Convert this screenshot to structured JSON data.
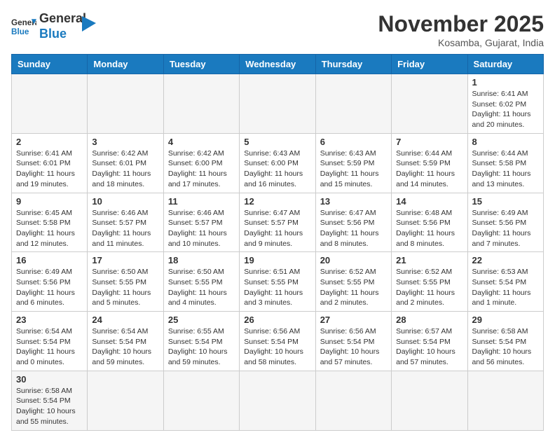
{
  "logo": {
    "text_general": "General",
    "text_blue": "Blue"
  },
  "header": {
    "month": "November 2025",
    "location": "Kosamba, Gujarat, India"
  },
  "weekdays": [
    "Sunday",
    "Monday",
    "Tuesday",
    "Wednesday",
    "Thursday",
    "Friday",
    "Saturday"
  ],
  "weeks": [
    [
      {
        "day": "",
        "info": ""
      },
      {
        "day": "",
        "info": ""
      },
      {
        "day": "",
        "info": ""
      },
      {
        "day": "",
        "info": ""
      },
      {
        "day": "",
        "info": ""
      },
      {
        "day": "",
        "info": ""
      },
      {
        "day": "1",
        "info": "Sunrise: 6:41 AM\nSunset: 6:02 PM\nDaylight: 11 hours\nand 20 minutes."
      }
    ],
    [
      {
        "day": "2",
        "info": "Sunrise: 6:41 AM\nSunset: 6:01 PM\nDaylight: 11 hours\nand 19 minutes."
      },
      {
        "day": "3",
        "info": "Sunrise: 6:42 AM\nSunset: 6:01 PM\nDaylight: 11 hours\nand 18 minutes."
      },
      {
        "day": "4",
        "info": "Sunrise: 6:42 AM\nSunset: 6:00 PM\nDaylight: 11 hours\nand 17 minutes."
      },
      {
        "day": "5",
        "info": "Sunrise: 6:43 AM\nSunset: 6:00 PM\nDaylight: 11 hours\nand 16 minutes."
      },
      {
        "day": "6",
        "info": "Sunrise: 6:43 AM\nSunset: 5:59 PM\nDaylight: 11 hours\nand 15 minutes."
      },
      {
        "day": "7",
        "info": "Sunrise: 6:44 AM\nSunset: 5:59 PM\nDaylight: 11 hours\nand 14 minutes."
      },
      {
        "day": "8",
        "info": "Sunrise: 6:44 AM\nSunset: 5:58 PM\nDaylight: 11 hours\nand 13 minutes."
      }
    ],
    [
      {
        "day": "9",
        "info": "Sunrise: 6:45 AM\nSunset: 5:58 PM\nDaylight: 11 hours\nand 12 minutes."
      },
      {
        "day": "10",
        "info": "Sunrise: 6:46 AM\nSunset: 5:57 PM\nDaylight: 11 hours\nand 11 minutes."
      },
      {
        "day": "11",
        "info": "Sunrise: 6:46 AM\nSunset: 5:57 PM\nDaylight: 11 hours\nand 10 minutes."
      },
      {
        "day": "12",
        "info": "Sunrise: 6:47 AM\nSunset: 5:57 PM\nDaylight: 11 hours\nand 9 minutes."
      },
      {
        "day": "13",
        "info": "Sunrise: 6:47 AM\nSunset: 5:56 PM\nDaylight: 11 hours\nand 8 minutes."
      },
      {
        "day": "14",
        "info": "Sunrise: 6:48 AM\nSunset: 5:56 PM\nDaylight: 11 hours\nand 8 minutes."
      },
      {
        "day": "15",
        "info": "Sunrise: 6:49 AM\nSunset: 5:56 PM\nDaylight: 11 hours\nand 7 minutes."
      }
    ],
    [
      {
        "day": "16",
        "info": "Sunrise: 6:49 AM\nSunset: 5:56 PM\nDaylight: 11 hours\nand 6 minutes."
      },
      {
        "day": "17",
        "info": "Sunrise: 6:50 AM\nSunset: 5:55 PM\nDaylight: 11 hours\nand 5 minutes."
      },
      {
        "day": "18",
        "info": "Sunrise: 6:50 AM\nSunset: 5:55 PM\nDaylight: 11 hours\nand 4 minutes."
      },
      {
        "day": "19",
        "info": "Sunrise: 6:51 AM\nSunset: 5:55 PM\nDaylight: 11 hours\nand 3 minutes."
      },
      {
        "day": "20",
        "info": "Sunrise: 6:52 AM\nSunset: 5:55 PM\nDaylight: 11 hours\nand 2 minutes."
      },
      {
        "day": "21",
        "info": "Sunrise: 6:52 AM\nSunset: 5:55 PM\nDaylight: 11 hours\nand 2 minutes."
      },
      {
        "day": "22",
        "info": "Sunrise: 6:53 AM\nSunset: 5:54 PM\nDaylight: 11 hours\nand 1 minute."
      }
    ],
    [
      {
        "day": "23",
        "info": "Sunrise: 6:54 AM\nSunset: 5:54 PM\nDaylight: 11 hours\nand 0 minutes."
      },
      {
        "day": "24",
        "info": "Sunrise: 6:54 AM\nSunset: 5:54 PM\nDaylight: 10 hours\nand 59 minutes."
      },
      {
        "day": "25",
        "info": "Sunrise: 6:55 AM\nSunset: 5:54 PM\nDaylight: 10 hours\nand 59 minutes."
      },
      {
        "day": "26",
        "info": "Sunrise: 6:56 AM\nSunset: 5:54 PM\nDaylight: 10 hours\nand 58 minutes."
      },
      {
        "day": "27",
        "info": "Sunrise: 6:56 AM\nSunset: 5:54 PM\nDaylight: 10 hours\nand 57 minutes."
      },
      {
        "day": "28",
        "info": "Sunrise: 6:57 AM\nSunset: 5:54 PM\nDaylight: 10 hours\nand 57 minutes."
      },
      {
        "day": "29",
        "info": "Sunrise: 6:58 AM\nSunset: 5:54 PM\nDaylight: 10 hours\nand 56 minutes."
      }
    ],
    [
      {
        "day": "30",
        "info": "Sunrise: 6:58 AM\nSunset: 5:54 PM\nDaylight: 10 hours\nand 55 minutes."
      },
      {
        "day": "",
        "info": ""
      },
      {
        "day": "",
        "info": ""
      },
      {
        "day": "",
        "info": ""
      },
      {
        "day": "",
        "info": ""
      },
      {
        "day": "",
        "info": ""
      },
      {
        "day": "",
        "info": ""
      }
    ]
  ]
}
